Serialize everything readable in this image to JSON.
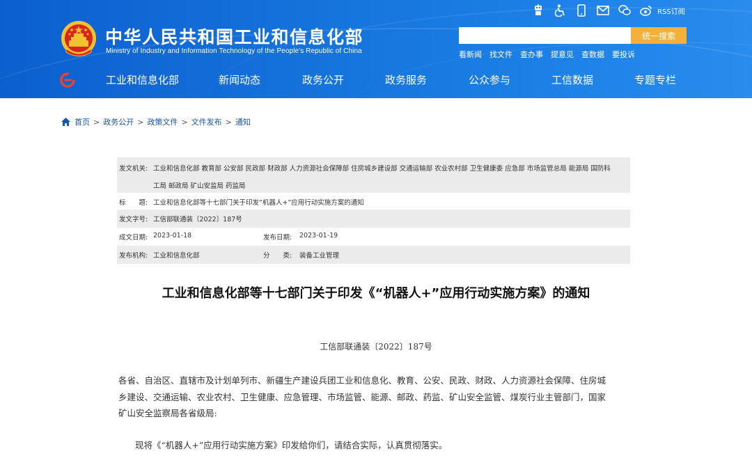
{
  "header": {
    "title_cn": "中华人民共和国工业和信息化部",
    "title_en": "Ministry of Industry and Information Technology of the People's Republic of China",
    "rss_label": "RSS订阅",
    "top_icons": [
      "robot-icon",
      "accessibility-icon",
      "mobile-icon",
      "mail-icon",
      "wechat-icon",
      "weibo-icon",
      "rss-icon"
    ],
    "search": {
      "placeholder": "",
      "button_label": "统一搜索"
    },
    "quick_links": [
      "看新闻",
      "找文件",
      "查办事",
      "提意见",
      "查数据",
      "要投诉"
    ],
    "nav": [
      "工业和信息化部",
      "新闻动态",
      "政务公开",
      "政务服务",
      "公众参与",
      "工信数据",
      "专题专栏"
    ],
    "colors": {
      "header_blue": "#1674dd",
      "search_button": "#f4b13a",
      "nav_logo": "#e8452c"
    }
  },
  "breadcrumb": [
    "首页",
    "政务公开",
    "政策文件",
    "文件发布",
    "通知"
  ],
  "meta": {
    "issuer_label": "发文机关:",
    "issuer_line1": "工业和信息化部 教育部 公安部 民政部 财政部 人力资源社会保障部 住房城乡建设部 交通运输部 农业农村部 卫生健康委 应急部 市场监管总局 能源局 国防科",
    "issuer_line2": "工局 邮政局 矿山安监局 药监局",
    "title_label": "标　　题:",
    "title_value": "工业和信息化部等十七部门关于印发“机器人+”应用行动实施方案的通知",
    "doc_no_label": "发文字号:",
    "doc_no_value": "工信部联通装〔2022〕187号",
    "created_label": "成文日期:",
    "created_value": "2023-01-18",
    "published_label": "发布日期:",
    "published_value": "2023-01-19",
    "org_label": "发布机构:",
    "org_value": "工业和信息化部",
    "category_label": "分　　类:",
    "category_value": "装备工业管理"
  },
  "article": {
    "title": "工业和信息化部等十七部门关于印发《“机器人+”应用行动实施方案》的通知",
    "doc_number": "工信部联通装〔2022〕187号",
    "addressee_lines": [
      "各省、自治区、直辖市及计划单列市、新疆生产建设兵团工业和信息化、教育、公安、民政、财政、人力资源社会保障、住房城",
      "乡建设、交通运输、农业农村、卫生健康、应急管理、市场监管、能源、邮政、药监、矿山安全监管、煤炭行业主管部门，国家",
      "矿山安全监察局各省级局:"
    ],
    "body_line": "现将《“机器人+”应用行动实施方案》印发给你们，请结合实际，认真贯彻落实。"
  }
}
